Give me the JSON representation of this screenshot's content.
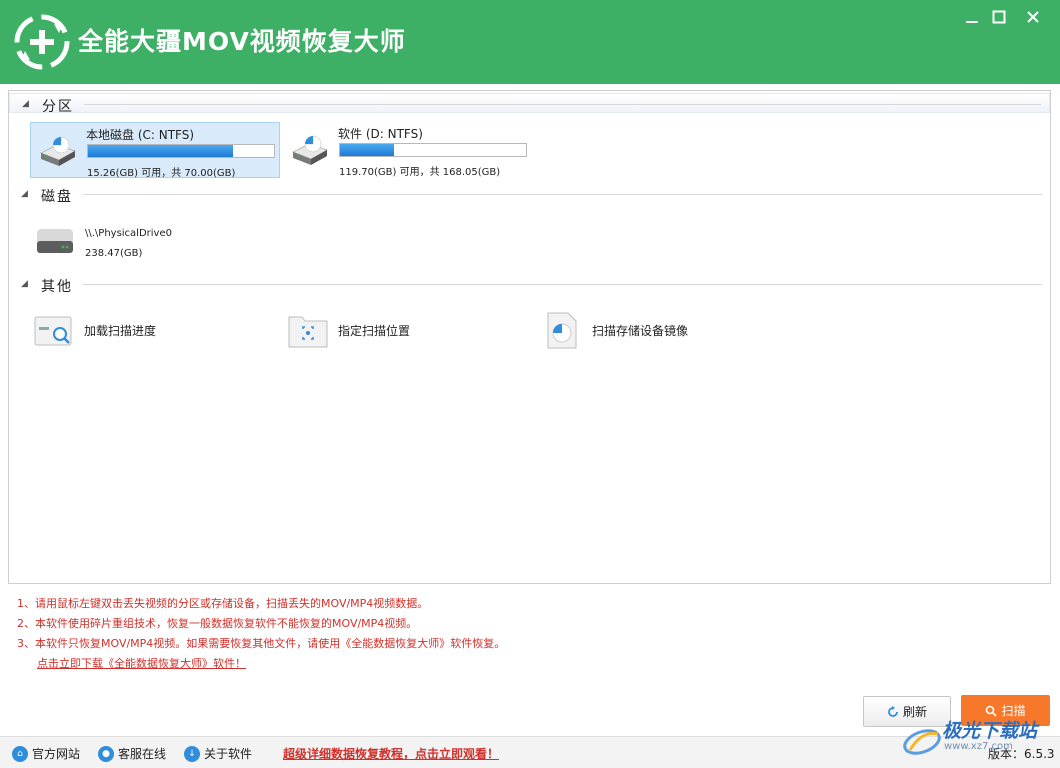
{
  "app": {
    "title": "全能大疆MOV视频恢复大师"
  },
  "sections": {
    "partition": "分区",
    "disk": "磁盘",
    "other": "其他"
  },
  "partitions": [
    {
      "name": "本地磁盘 (C: NTFS)",
      "info": "15.26(GB) 可用，共 70.00(GB)",
      "used_fraction": 0.78
    },
    {
      "name": "软件 (D: NTFS)",
      "info": "119.70(GB) 可用，共 168.05(GB)",
      "used_fraction": 0.29
    }
  ],
  "disks": [
    {
      "name": "\\\\.\\PhysicalDrive0",
      "size": "238.47(GB)"
    }
  ],
  "others": [
    {
      "label": "加载扫描进度",
      "icon": "scan-progress-icon"
    },
    {
      "label": "指定扫描位置",
      "icon": "folder-target-icon"
    },
    {
      "label": "扫描存储设备镜像",
      "icon": "disk-image-icon"
    }
  ],
  "notes": {
    "n1": "1、请用鼠标左键双击丢失视频的分区或存储设备，扫描丢失的MOV/MP4视频数据。",
    "n2": "2、本软件使用碎片重组技术，恢复一般数据恢复软件不能恢复的MOV/MP4视频。",
    "n3": "3、本软件只恢复MOV/MP4视频。如果需要恢复其他文件，请使用《全能数据恢复大师》软件恢复。",
    "download": "点击立即下载《全能数据恢复大师》软件！"
  },
  "buttons": {
    "refresh": "刷新",
    "scan": "扫描"
  },
  "statusbar": {
    "website": "官方网站",
    "service": "客服在线",
    "about": "关于软件",
    "tutorial": "超级详细数据恢复教程，点击立即观看！",
    "version": "版本：6.5.3"
  },
  "watermark": {
    "text": "极光下载站",
    "sub": "www.xz7.com"
  },
  "colors": {
    "titlebar": "#3db066",
    "accent_red": "#d0312b",
    "scan_button": "#f7782a",
    "bar_fill": "#1f7ad6"
  }
}
